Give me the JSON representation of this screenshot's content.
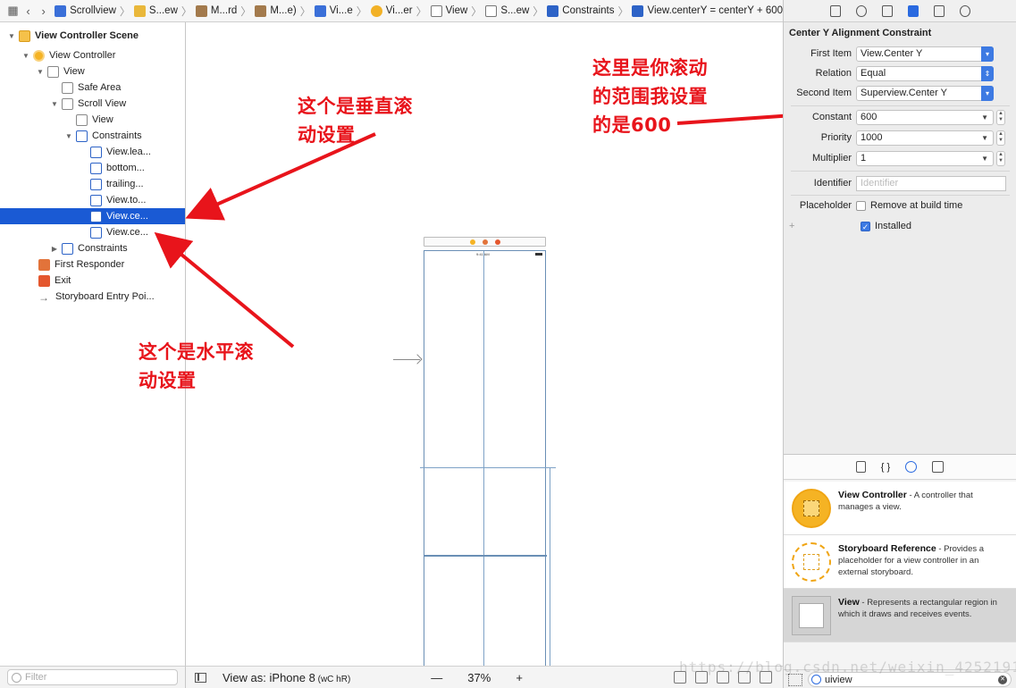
{
  "jumpbar": {
    "crumbs": [
      "Scrollview",
      "S...ew",
      "M...rd",
      "M...e)",
      "Vi...e",
      "Vi...er",
      "View",
      "S...ew",
      "Constraints",
      "View.centerY = centerY + 600"
    ]
  },
  "navigator": {
    "items": [
      {
        "label": "View Controller Scene"
      },
      {
        "label": "View Controller"
      },
      {
        "label": "View"
      },
      {
        "label": "Safe Area"
      },
      {
        "label": "Scroll View"
      },
      {
        "label": "View"
      },
      {
        "label": "Constraints"
      },
      {
        "label": "View.lea..."
      },
      {
        "label": "bottom..."
      },
      {
        "label": "trailing..."
      },
      {
        "label": "View.to..."
      },
      {
        "label": "View.ce..."
      },
      {
        "label": "View.ce..."
      },
      {
        "label": "Constraints"
      },
      {
        "label": "First Responder"
      },
      {
        "label": "Exit"
      },
      {
        "label": "Storyboard Entry Poi..."
      }
    ],
    "filter_placeholder": "Filter"
  },
  "canvas": {
    "status_bar_time": "9:41 AM",
    "view_as_prefix": "View as: ",
    "device": "iPhone 8",
    "size_class": " (wC hR)",
    "zoom_minus": "—",
    "zoom": "37%",
    "zoom_plus": "+"
  },
  "annotations": {
    "vertical_line1": "这个是垂直滚",
    "vertical_line2": "动设置",
    "horizontal_line1": "这个是水平滚",
    "horizontal_line2": "动设置",
    "range_line1": "这里是你滚动",
    "range_line2": "的范围我设置",
    "range_line3": "的是600"
  },
  "inspector": {
    "title": "Center Y Alignment Constraint",
    "first_item_label": "First Item",
    "first_item_value": "View.Center Y",
    "relation_label": "Relation",
    "relation_value": "Equal",
    "second_item_label": "Second Item",
    "second_item_value": "Superview.Center Y",
    "constant_label": "Constant",
    "constant_value": "600",
    "priority_label": "Priority",
    "priority_value": "1000",
    "multiplier_label": "Multiplier",
    "multiplier_value": "1",
    "identifier_label": "Identifier",
    "identifier_placeholder": "Identifier",
    "placeholder_label": "Placeholder",
    "remove_at_build_label": "Remove at build time",
    "add_symbol": "+",
    "installed_label": "Installed"
  },
  "library": {
    "items": [
      {
        "name": "View Controller",
        "desc": " - A controller that manages a view."
      },
      {
        "name": "Storyboard Reference",
        "desc": " - Provides a placeholder for a view controller in an external storyboard."
      },
      {
        "name": "View",
        "desc": " - Represents a rectangular region in which it draws and receives events."
      }
    ],
    "filter_value": "uiview"
  },
  "watermark": "https://blog.csdn.net/weixin_42521913",
  "colors": {
    "selection": "#1a5ad4",
    "annotation": "#e8141b",
    "accent": "#3d7ae3"
  }
}
